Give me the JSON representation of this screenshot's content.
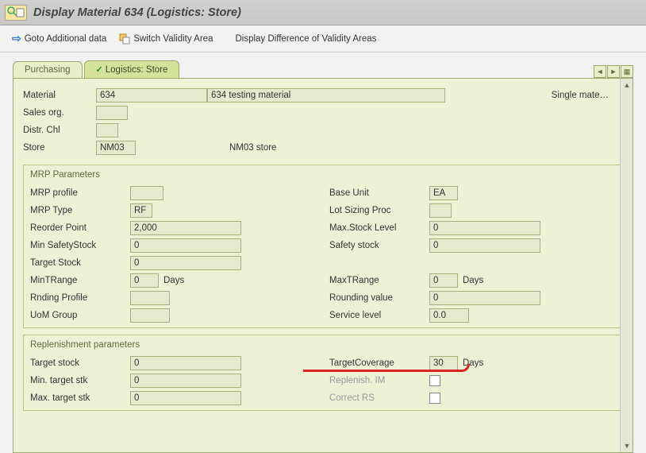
{
  "title": "Display Material 634 (Logistics: Store)",
  "toolbar": {
    "goto": "Goto Additional data",
    "switch": "Switch Validity Area",
    "diff": "Display Difference of Validity Areas"
  },
  "tabs": {
    "purchasing": "Purchasing",
    "logistics": "Logistics: Store"
  },
  "head": {
    "material_lbl": "Material",
    "material_val": "634",
    "material_desc": "634 testing material",
    "single": "Single mate…",
    "salesorg_lbl": "Sales org.",
    "salesorg_val": "",
    "distr_lbl": "Distr. Chl",
    "distr_val": "",
    "store_lbl": "Store",
    "store_val": "NM03",
    "store_desc": "NM03 store"
  },
  "mrp": {
    "title": "MRP Parameters",
    "profile_lbl": "MRP profile",
    "profile_val": "",
    "type_lbl": "MRP Type",
    "type_val": "RF",
    "reorder_lbl": "Reorder Point",
    "reorder_val": "2,000",
    "minsafety_lbl": "Min SafetyStock",
    "minsafety_val": "0",
    "tstock_lbl": "Target Stock",
    "tstock_val": "0",
    "mintr_lbl": "MinTRange",
    "mintr_val": "0",
    "days": "Days",
    "rnd_lbl": "Rnding Profile",
    "rnd_val": "",
    "uom_lbl": "UoM Group",
    "uom_val": "",
    "baseunit_lbl": "Base Unit",
    "baseunit_val": "EA",
    "lot_lbl": "Lot Sizing Proc",
    "lot_val": "",
    "maxstock_lbl": "Max.Stock Level",
    "maxstock_val": "0",
    "safety_lbl": "Safety stock",
    "safety_val": "0",
    "maxtr_lbl": "MaxTRange",
    "maxtr_val": "0",
    "roundv_lbl": "Rounding value",
    "roundv_val": "0",
    "service_lbl": "Service level",
    "service_val": "0.0"
  },
  "rep": {
    "title": "Replenishment parameters",
    "tstock_lbl": "Target stock",
    "tstock_val": "0",
    "min_lbl": "Min. target stk",
    "min_val": "0",
    "max_lbl": "Max. target stk",
    "max_val": "0",
    "cov_lbl": "TargetCoverage",
    "cov_val": "30",
    "days": "Days",
    "rim_lbl": "Replenish. IM",
    "crs_lbl": "Correct RS"
  }
}
